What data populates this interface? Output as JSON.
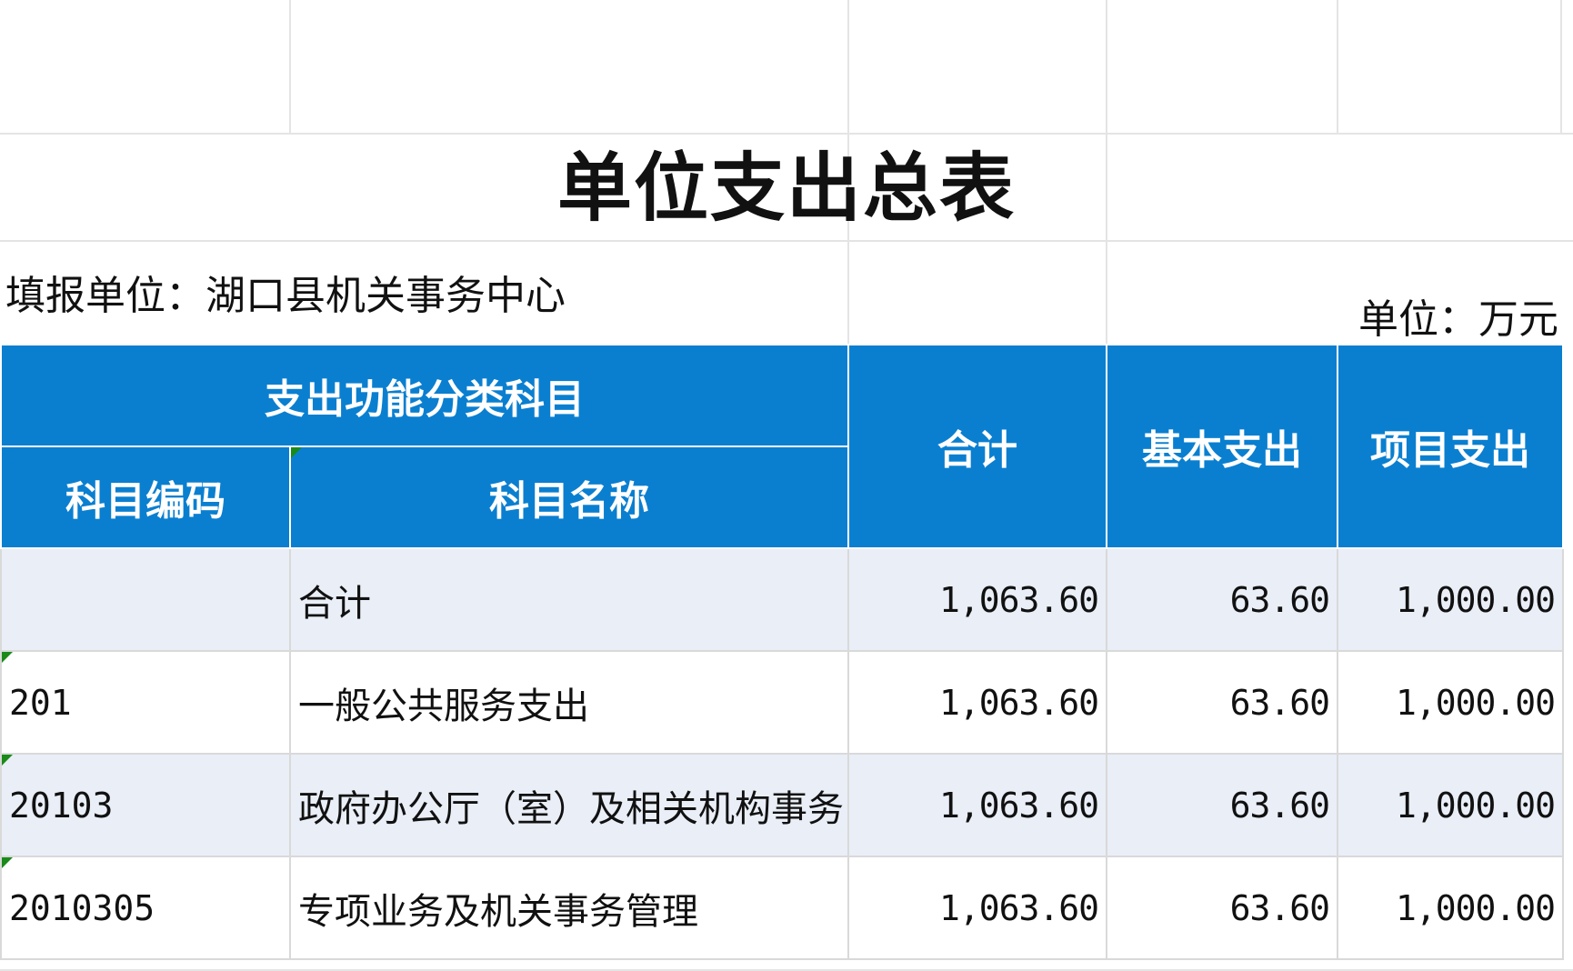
{
  "title": "单位支出总表",
  "reporting_unit": "填报单位：湖口县机关事务中心",
  "unit_label": "单位：万元",
  "headers": {
    "group": "支出功能分类科目",
    "code": "科目编码",
    "name": "科目名称",
    "total": "合计",
    "basic": "基本支出",
    "project": "项目支出"
  },
  "rows": [
    {
      "code": "",
      "name": "合计",
      "total": "1,063.60",
      "basic": "63.60",
      "project": "1,000.00"
    },
    {
      "code": "201",
      "name": "一般公共服务支出",
      "total": "1,063.60",
      "basic": "63.60",
      "project": "1,000.00"
    },
    {
      "code": "20103",
      "name": "政府办公厅（室）及相关机构事务",
      "total": "1,063.60",
      "basic": "63.60",
      "project": "1,000.00"
    },
    {
      "code": "2010305",
      "name": "专项业务及机关事务管理",
      "total": "1,063.60",
      "basic": "63.60",
      "project": "1,000.00"
    }
  ]
}
